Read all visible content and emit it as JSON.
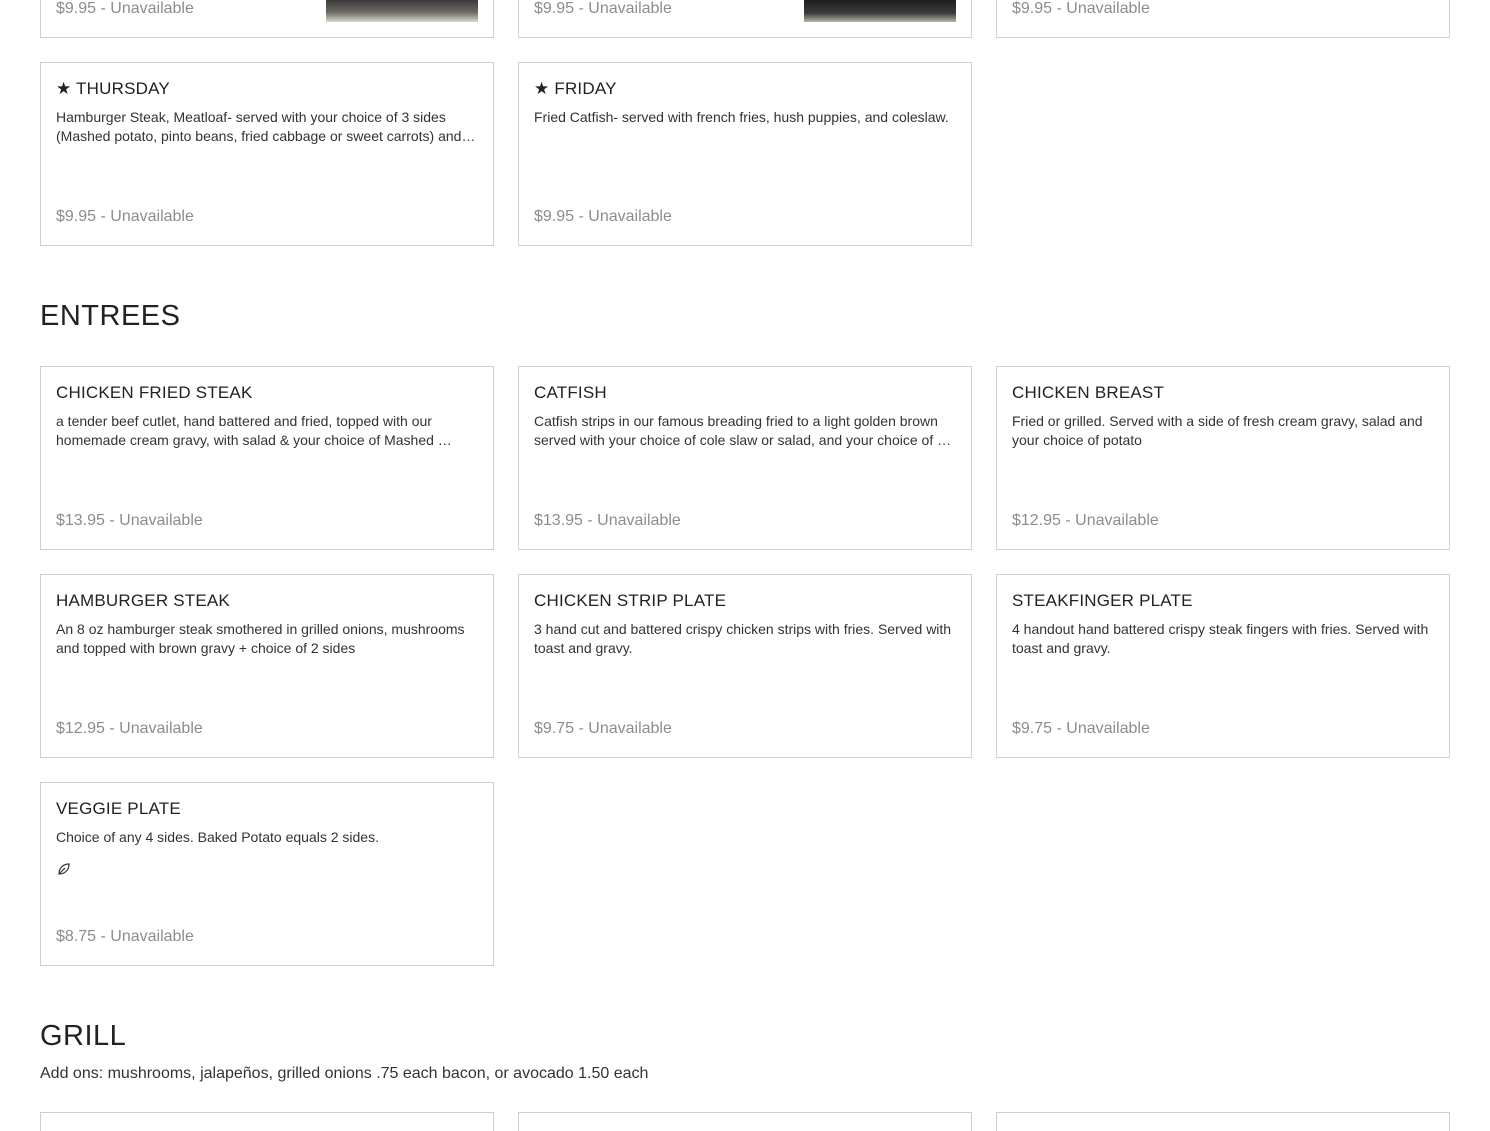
{
  "specials": {
    "top_row": [
      {
        "price": "$9.95 - Unavailable"
      },
      {
        "price": "$9.95 - Unavailable"
      },
      {
        "price": "$9.95 - Unavailable"
      }
    ],
    "items": [
      {
        "title": "★ THURSDAY",
        "description": "Hamburger Steak, Meatloaf- served with your choice of 3 sides (Mashed potato, pinto beans, fried cabbage or sweet carrots) and…",
        "price": "$9.95 - Unavailable"
      },
      {
        "title": "★ FRIDAY",
        "description": "Fried Catfish- served with french fries, hush puppies, and coleslaw.",
        "price": "$9.95 - Unavailable"
      }
    ]
  },
  "entrees": {
    "title": "ENTREES",
    "items": [
      {
        "title": "CHICKEN FRIED STEAK",
        "description": "a tender beef cutlet, hand battered and fried, topped with our homemade cream gravy, with salad &  your choice of Mashed …",
        "price": "$13.95 - Unavailable"
      },
      {
        "title": "CATFISH",
        "description": "Catfish strips in our famous breading fried to a light golden brown served with your choice of cole slaw or salad, and your choice of …",
        "price": "$13.95 - Unavailable"
      },
      {
        "title": "CHICKEN BREAST",
        "description": "Fried or grilled. Served with a side of fresh cream gravy, salad and your choice of potato",
        "price": "$12.95 - Unavailable"
      },
      {
        "title": "HAMBURGER STEAK",
        "description": "An 8 oz hamburger steak smothered in grilled onions, mushrooms and topped with brown gravy + choice of 2 sides",
        "price": "$12.95 - Unavailable"
      },
      {
        "title": "CHICKEN STRIP PLATE",
        "description": "3 hand cut and battered crispy chicken strips with fries. Served with toast and gravy.",
        "price": "$9.75 - Unavailable"
      },
      {
        "title": "STEAKFINGER PLATE",
        "description": "4 handout hand battered crispy steak fingers with fries. Served with toast and gravy.",
        "price": "$9.75 - Unavailable"
      },
      {
        "title": "VEGGIE PLATE",
        "description": "Choice of any 4 sides. Baked Potato equals 2 sides.",
        "price": "$8.75 - Unavailable",
        "icon": "vegetarian-leaf-icon"
      }
    ]
  },
  "grill": {
    "title": "GRILL",
    "note": "Add ons: mushrooms, jalapeños, grilled onions .75 each bacon, or avocado 1.50 each"
  },
  "colors": {
    "border": "#cfcfcf",
    "price_text": "#8c8c8c",
    "heading_text": "#222222"
  }
}
